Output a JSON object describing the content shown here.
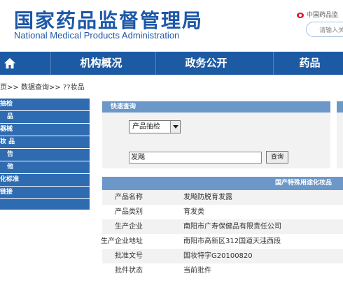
{
  "header": {
    "logo_cn": "国家药品监督管理局",
    "logo_en": "National Medical Products Administration",
    "weibo_text": "中国药品监",
    "search_placeholder": "请输入关"
  },
  "nav": {
    "items": [
      {
        "label": "机构概况"
      },
      {
        "label": "政务公开"
      },
      {
        "label": "药品"
      }
    ]
  },
  "breadcrumb": {
    "first": "页",
    "second": "数据查询",
    "third": "??妆品",
    "separator": ">>"
  },
  "sidebar": {
    "items": [
      {
        "label": "抽检"
      },
      {
        "label": "品"
      },
      {
        "label": "器械"
      },
      {
        "label": "妆 品"
      },
      {
        "label": "告"
      },
      {
        "label": "他"
      },
      {
        "label": "化标准"
      },
      {
        "label": "链接"
      },
      {
        "label": ""
      }
    ]
  },
  "quick_query": {
    "title": "快速查询",
    "select_value": "产品抽检",
    "input_value": "发飚",
    "button_label": "查询"
  },
  "result": {
    "title": "国产特殊用途化妆品",
    "rows": [
      {
        "label": "产品名称",
        "value": "发飚防脱育发露"
      },
      {
        "label": "产品类别",
        "value": "育发类"
      },
      {
        "label": "生产企业",
        "value": "南阳市广寿保健品有限责任公司"
      },
      {
        "label": "生产企业地址",
        "value": "南阳市高新区312国道天洼西段"
      },
      {
        "label": "批准文号",
        "value": "国妆特字G20100820"
      },
      {
        "label": "批件状态",
        "value": "当前批件"
      }
    ]
  },
  "colors": {
    "brand_blue": "#1d57a8",
    "nav_blue": "#1c5aa3",
    "panel_header": "#6b97c9",
    "weibo_red": "#e6162d"
  }
}
